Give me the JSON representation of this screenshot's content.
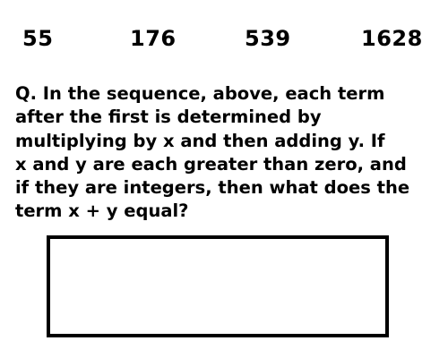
{
  "sequence": {
    "terms": [
      "55",
      "176",
      "539",
      "1628"
    ]
  },
  "question": {
    "text": "Q. In the sequence, above, each term\nafter the first is determined by\nmultiplying by x and then adding y. If\nx and y are each greater than zero, and\nif they are integers, then what does the\nterm x + y equal?"
  },
  "answer": {
    "value": ""
  },
  "colors": {
    "text": "#000000",
    "background": "#ffffff",
    "border": "#000000"
  }
}
